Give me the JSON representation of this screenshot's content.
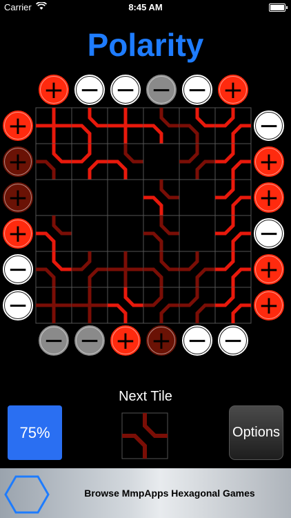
{
  "status_bar": {
    "carrier": "Carrier",
    "time": "8:45 AM"
  },
  "title": "Polarity",
  "colors": {
    "red": "#ff2a0e",
    "dark_red": "#6a1205",
    "white": "#ffffff",
    "gray": "#8a8a8a",
    "trace": "#e8190c",
    "trace_dim": "#7a0e06",
    "grid": "#555555",
    "accent_blue": "#1e7cff"
  },
  "board": {
    "rows": 6,
    "cols": 6,
    "top_terminals": [
      {
        "sign": "+",
        "color": "red"
      },
      {
        "sign": "−",
        "color": "white"
      },
      {
        "sign": "−",
        "color": "white"
      },
      {
        "sign": "−",
        "color": "gray"
      },
      {
        "sign": "−",
        "color": "white"
      },
      {
        "sign": "+",
        "color": "red"
      }
    ],
    "bottom_terminals": [
      {
        "sign": "−",
        "color": "gray"
      },
      {
        "sign": "−",
        "color": "gray"
      },
      {
        "sign": "+",
        "color": "red"
      },
      {
        "sign": "+",
        "color": "dark_red"
      },
      {
        "sign": "−",
        "color": "white"
      },
      {
        "sign": "−",
        "color": "white"
      }
    ],
    "left_terminals": [
      {
        "sign": "+",
        "color": "red"
      },
      {
        "sign": "+",
        "color": "dark_red"
      },
      {
        "sign": "+",
        "color": "dark_red"
      },
      {
        "sign": "+",
        "color": "red"
      },
      {
        "sign": "−",
        "color": "white"
      },
      {
        "sign": "−",
        "color": "white"
      }
    ],
    "right_terminals": [
      {
        "sign": "−",
        "color": "white"
      },
      {
        "sign": "+",
        "color": "red"
      },
      {
        "sign": "+",
        "color": "red"
      },
      {
        "sign": "−",
        "color": "white"
      },
      {
        "sign": "+",
        "color": "red"
      },
      {
        "sign": "+",
        "color": "red"
      }
    ],
    "tiles": [
      [
        {
          "paths": [
            [
              "N",
              "S"
            ],
            [
              "W",
              "E"
            ]
          ],
          "lit": [
            true,
            true
          ]
        },
        {
          "paths": [
            [
              "N",
              "E"
            ],
            [
              "W",
              "S"
            ]
          ],
          "lit": [
            true,
            true
          ]
        },
        {
          "paths": [
            [
              "N",
              "S"
            ],
            [
              "W",
              "E"
            ]
          ],
          "lit": [
            true,
            true
          ]
        },
        {
          "paths": [
            [
              "N",
              "E"
            ],
            [
              "W",
              "S"
            ]
          ],
          "lit": [
            false,
            true
          ]
        },
        {
          "paths": [
            [
              "N",
              "E"
            ],
            [
              "W",
              "S"
            ]
          ],
          "lit": [
            true,
            false
          ]
        },
        {
          "paths": [
            [
              "N",
              "W"
            ],
            [
              "S",
              "E"
            ]
          ],
          "lit": [
            true,
            true
          ]
        }
      ],
      [
        {
          "paths": [
            [
              "N",
              "E"
            ],
            [
              "W",
              "S"
            ]
          ],
          "lit": [
            true,
            false
          ]
        },
        {
          "paths": [
            [
              "N",
              "W"
            ],
            [
              "S",
              "E"
            ]
          ],
          "lit": [
            true,
            true
          ]
        },
        {
          "paths": [
            [
              "N",
              "E"
            ],
            [
              "W",
              "S"
            ]
          ],
          "lit": [
            false,
            true
          ]
        },
        {
          "paths": [],
          "lit": []
        },
        {
          "paths": [
            [
              "N",
              "W"
            ],
            [
              "S",
              "E"
            ]
          ],
          "lit": [
            false,
            false
          ]
        },
        {
          "paths": [
            [
              "N",
              "W"
            ],
            [
              "S",
              "E"
            ]
          ],
          "lit": [
            true,
            true
          ]
        }
      ],
      [
        {
          "paths": [],
          "lit": []
        },
        {
          "paths": [],
          "lit": []
        },
        {
          "paths": [],
          "lit": []
        },
        {
          "paths": [
            [
              "N",
              "E"
            ],
            [
              "W",
              "S"
            ]
          ],
          "lit": [
            false,
            true
          ]
        },
        {
          "paths": [],
          "lit": []
        },
        {
          "paths": [
            [
              "N",
              "W"
            ],
            [
              "S",
              "E"
            ]
          ],
          "lit": [
            true,
            true
          ]
        }
      ],
      [
        {
          "paths": [
            [
              "N",
              "E"
            ],
            [
              "W",
              "S"
            ]
          ],
          "lit": [
            false,
            true
          ]
        },
        {
          "paths": [],
          "lit": []
        },
        {
          "paths": [],
          "lit": []
        },
        {
          "paths": [
            [
              "N",
              "E"
            ],
            [
              "W",
              "S"
            ]
          ],
          "lit": [
            false,
            false
          ]
        },
        {
          "paths": [],
          "lit": []
        },
        {
          "paths": [
            [
              "N",
              "W"
            ],
            [
              "S",
              "E"
            ]
          ],
          "lit": [
            true,
            true
          ]
        }
      ],
      [
        {
          "paths": [
            [
              "N",
              "E"
            ],
            [
              "W",
              "S"
            ]
          ],
          "lit": [
            true,
            false
          ]
        },
        {
          "paths": [
            [
              "N",
              "W"
            ],
            [
              "S",
              "E"
            ]
          ],
          "lit": [
            false,
            false
          ]
        },
        {
          "paths": [
            [
              "N",
              "S"
            ],
            [
              "W",
              "E"
            ]
          ],
          "lit": [
            false,
            false
          ]
        },
        {
          "paths": [
            [
              "N",
              "E"
            ],
            [
              "W",
              "S"
            ]
          ],
          "lit": [
            false,
            false
          ]
        },
        {
          "paths": [
            [
              "N",
              "W"
            ],
            [
              "S",
              "E"
            ]
          ],
          "lit": [
            false,
            false
          ]
        },
        {
          "paths": [
            [
              "N",
              "W"
            ],
            [
              "S",
              "E"
            ]
          ],
          "lit": [
            true,
            true
          ]
        }
      ],
      [
        {
          "paths": [
            [
              "N",
              "S"
            ],
            [
              "W",
              "E"
            ]
          ],
          "lit": [
            false,
            false
          ]
        },
        {
          "paths": [
            [
              "N",
              "S"
            ],
            [
              "W",
              "E"
            ]
          ],
          "lit": [
            false,
            false
          ]
        },
        {
          "paths": [
            [
              "N",
              "E"
            ],
            [
              "W",
              "S"
            ]
          ],
          "lit": [
            true,
            true
          ]
        },
        {
          "paths": [
            [
              "N",
              "W"
            ],
            [
              "S",
              "E"
            ]
          ],
          "lit": [
            false,
            false
          ]
        },
        {
          "paths": [
            [
              "N",
              "W"
            ],
            [
              "S",
              "E"
            ]
          ],
          "lit": [
            false,
            false
          ]
        },
        {
          "paths": [
            [
              "N",
              "W"
            ],
            [
              "S",
              "E"
            ]
          ],
          "lit": [
            true,
            true
          ]
        }
      ]
    ]
  },
  "next_tile": {
    "label": "Next Tile",
    "paths": [
      [
        "N",
        "E"
      ],
      [
        "W",
        "S"
      ]
    ],
    "lit": [
      false,
      false
    ]
  },
  "progress": {
    "label": "75%",
    "percent": 75
  },
  "options_label": "Options",
  "banner": {
    "text": "Browse MmpApps Hexagonal Games",
    "icon": "hexagon-icon"
  }
}
